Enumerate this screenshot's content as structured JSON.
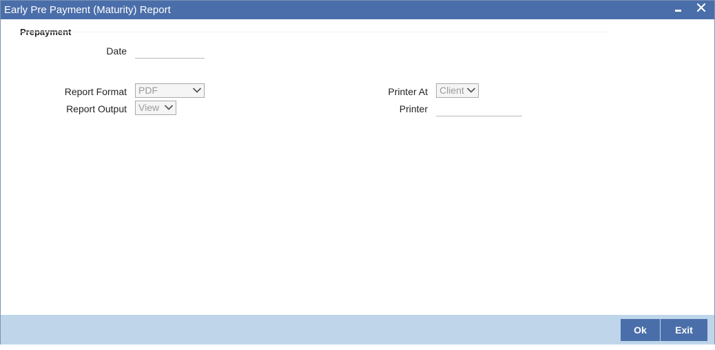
{
  "window": {
    "title": "Early Pre Payment (Maturity) Report"
  },
  "section": {
    "title": "Prepayment"
  },
  "fields": {
    "date": {
      "label": "Date",
      "value": ""
    },
    "report_format": {
      "label": "Report Format",
      "value": "PDF"
    },
    "report_output": {
      "label": "Report Output",
      "value": "View"
    },
    "printer_at": {
      "label": "Printer At",
      "value": "Client"
    },
    "printer": {
      "label": "Printer",
      "value": ""
    }
  },
  "buttons": {
    "ok": "Ok",
    "exit": "Exit"
  },
  "colors": {
    "titlebar": "#4a6ea9",
    "footer": "#bfd6ea",
    "button": "#4a6ea9"
  }
}
